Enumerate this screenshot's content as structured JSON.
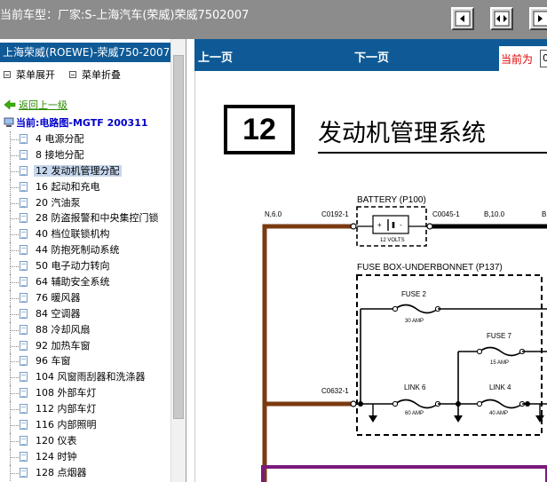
{
  "window": {
    "title": "当前车型：厂家:S-上海汽车(荣威)荣威7502007",
    "toolbar_buttons": [
      "prev-page-button",
      "fit-page-button",
      "next-page-button"
    ]
  },
  "sidebar": {
    "header": "上海荣威(ROEWE)-荣威750-2007",
    "expand_label": "菜单展开",
    "collapse_label": "菜单折叠",
    "back_label": "返回上一级",
    "current_label": "当前:电路图-MGTF 200311",
    "items": [
      {
        "label": "4 电源分配"
      },
      {
        "label": "8 接地分配"
      },
      {
        "label": "12 发动机管理分配",
        "selected": true
      },
      {
        "label": "16 起动和充电"
      },
      {
        "label": "20 汽油泵"
      },
      {
        "label": "28 防盗报警和中央集控门锁"
      },
      {
        "label": "40 档位联锁机构"
      },
      {
        "label": "44 防抱死制动系统"
      },
      {
        "label": "50 电子动力转向"
      },
      {
        "label": "64 辅助安全系统"
      },
      {
        "label": "76 暖风器"
      },
      {
        "label": "84 空调器"
      },
      {
        "label": "88 冷却风扇"
      },
      {
        "label": "92 加热车窗"
      },
      {
        "label": "96 车窗"
      },
      {
        "label": "104 风窗雨刮器和洗涤器"
      },
      {
        "label": "108 外部车灯"
      },
      {
        "label": "112 内部车灯"
      },
      {
        "label": "116 内部照明"
      },
      {
        "label": "120 仪表"
      },
      {
        "label": "124 时钟"
      },
      {
        "label": "128 点烟器"
      }
    ]
  },
  "navbar": {
    "prev_label": "上一页",
    "next_label": "下一页",
    "current_label": "当前为",
    "current_value": "0"
  },
  "diagram": {
    "section_number": "12",
    "section_title": "发动机管理系统",
    "battery_label": "BATTERY (P100)",
    "battery_plus": "+",
    "battery_minus": "-",
    "battery_volts": "12 VOLTS",
    "wire_n6": "N,6.0",
    "conn_c0192": "C0192-1",
    "conn_c0045": "C0045-1",
    "wire_b10": "B,10.0",
    "wire_b_cut": "B",
    "fusebox_label": "FUSE BOX-UNDERBONNET (P137)",
    "fuse2_label": "FUSE 2",
    "fuse2_amp": "30 AMP",
    "fuse7_label": "FUSE 7",
    "fuse7_amp": "15 AMP",
    "link6_label": "LINK 6",
    "link6_amp": "60 AMP",
    "link4_label": "LINK 4",
    "link4_amp": "40 AMP",
    "conn_c0632": "C0632-1"
  }
}
